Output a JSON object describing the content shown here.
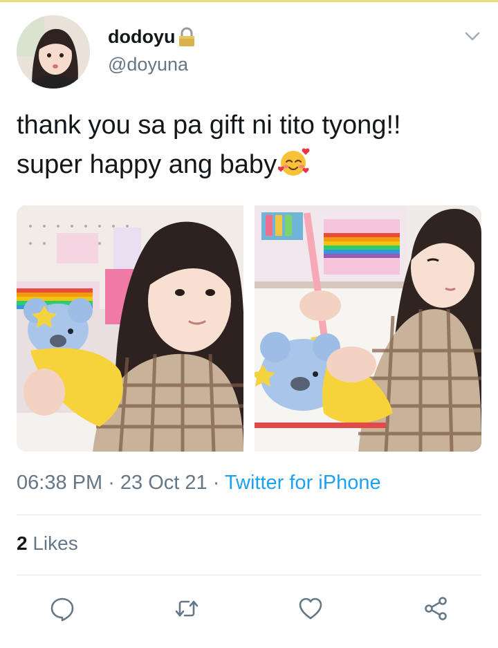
{
  "tweet": {
    "author": {
      "display_name": "dodoyu",
      "handle": "@doyuna",
      "protected_icon": "lock-icon",
      "avatar": "avatar"
    },
    "text_line1": "thank you sa pa gift ni tito tyong!!",
    "text_line2": "super happy ang baby",
    "emoji": "smiling-face-with-hearts-icon",
    "media": [
      {
        "name": "photo-girl-holding-koala-pouch"
      },
      {
        "name": "photo-girl-with-pencil-and-koala-pouch"
      }
    ],
    "time": "06:38 PM",
    "separator": " · ",
    "date": "23 Oct 21",
    "source": "Twitter for iPhone",
    "likes_count": "2",
    "likes_label": " Likes"
  },
  "actions": [
    {
      "name": "reply",
      "icon": "comment-icon"
    },
    {
      "name": "retweet",
      "icon": "retweet-icon"
    },
    {
      "name": "like",
      "icon": "heart-icon"
    },
    {
      "name": "share",
      "icon": "share-icon"
    }
  ],
  "colors": {
    "text": "#14171a",
    "secondary": "#657786",
    "link": "#1da1f2",
    "divider": "#dfe6eb"
  }
}
